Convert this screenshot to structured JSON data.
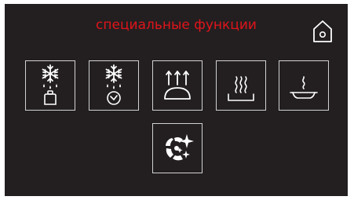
{
  "screen": {
    "title": "специальные функции",
    "title_color": "#e0141b",
    "background": "#231f20"
  },
  "home_button": {
    "icon": "home-icon"
  },
  "functions": [
    {
      "icon": "defrost-by-weight-icon"
    },
    {
      "icon": "defrost-by-time-icon"
    },
    {
      "icon": "plate-warming-icon"
    },
    {
      "icon": "keep-warm-icon"
    },
    {
      "icon": "slow-cooking-icon"
    },
    {
      "icon": "cleaning-icon"
    }
  ]
}
